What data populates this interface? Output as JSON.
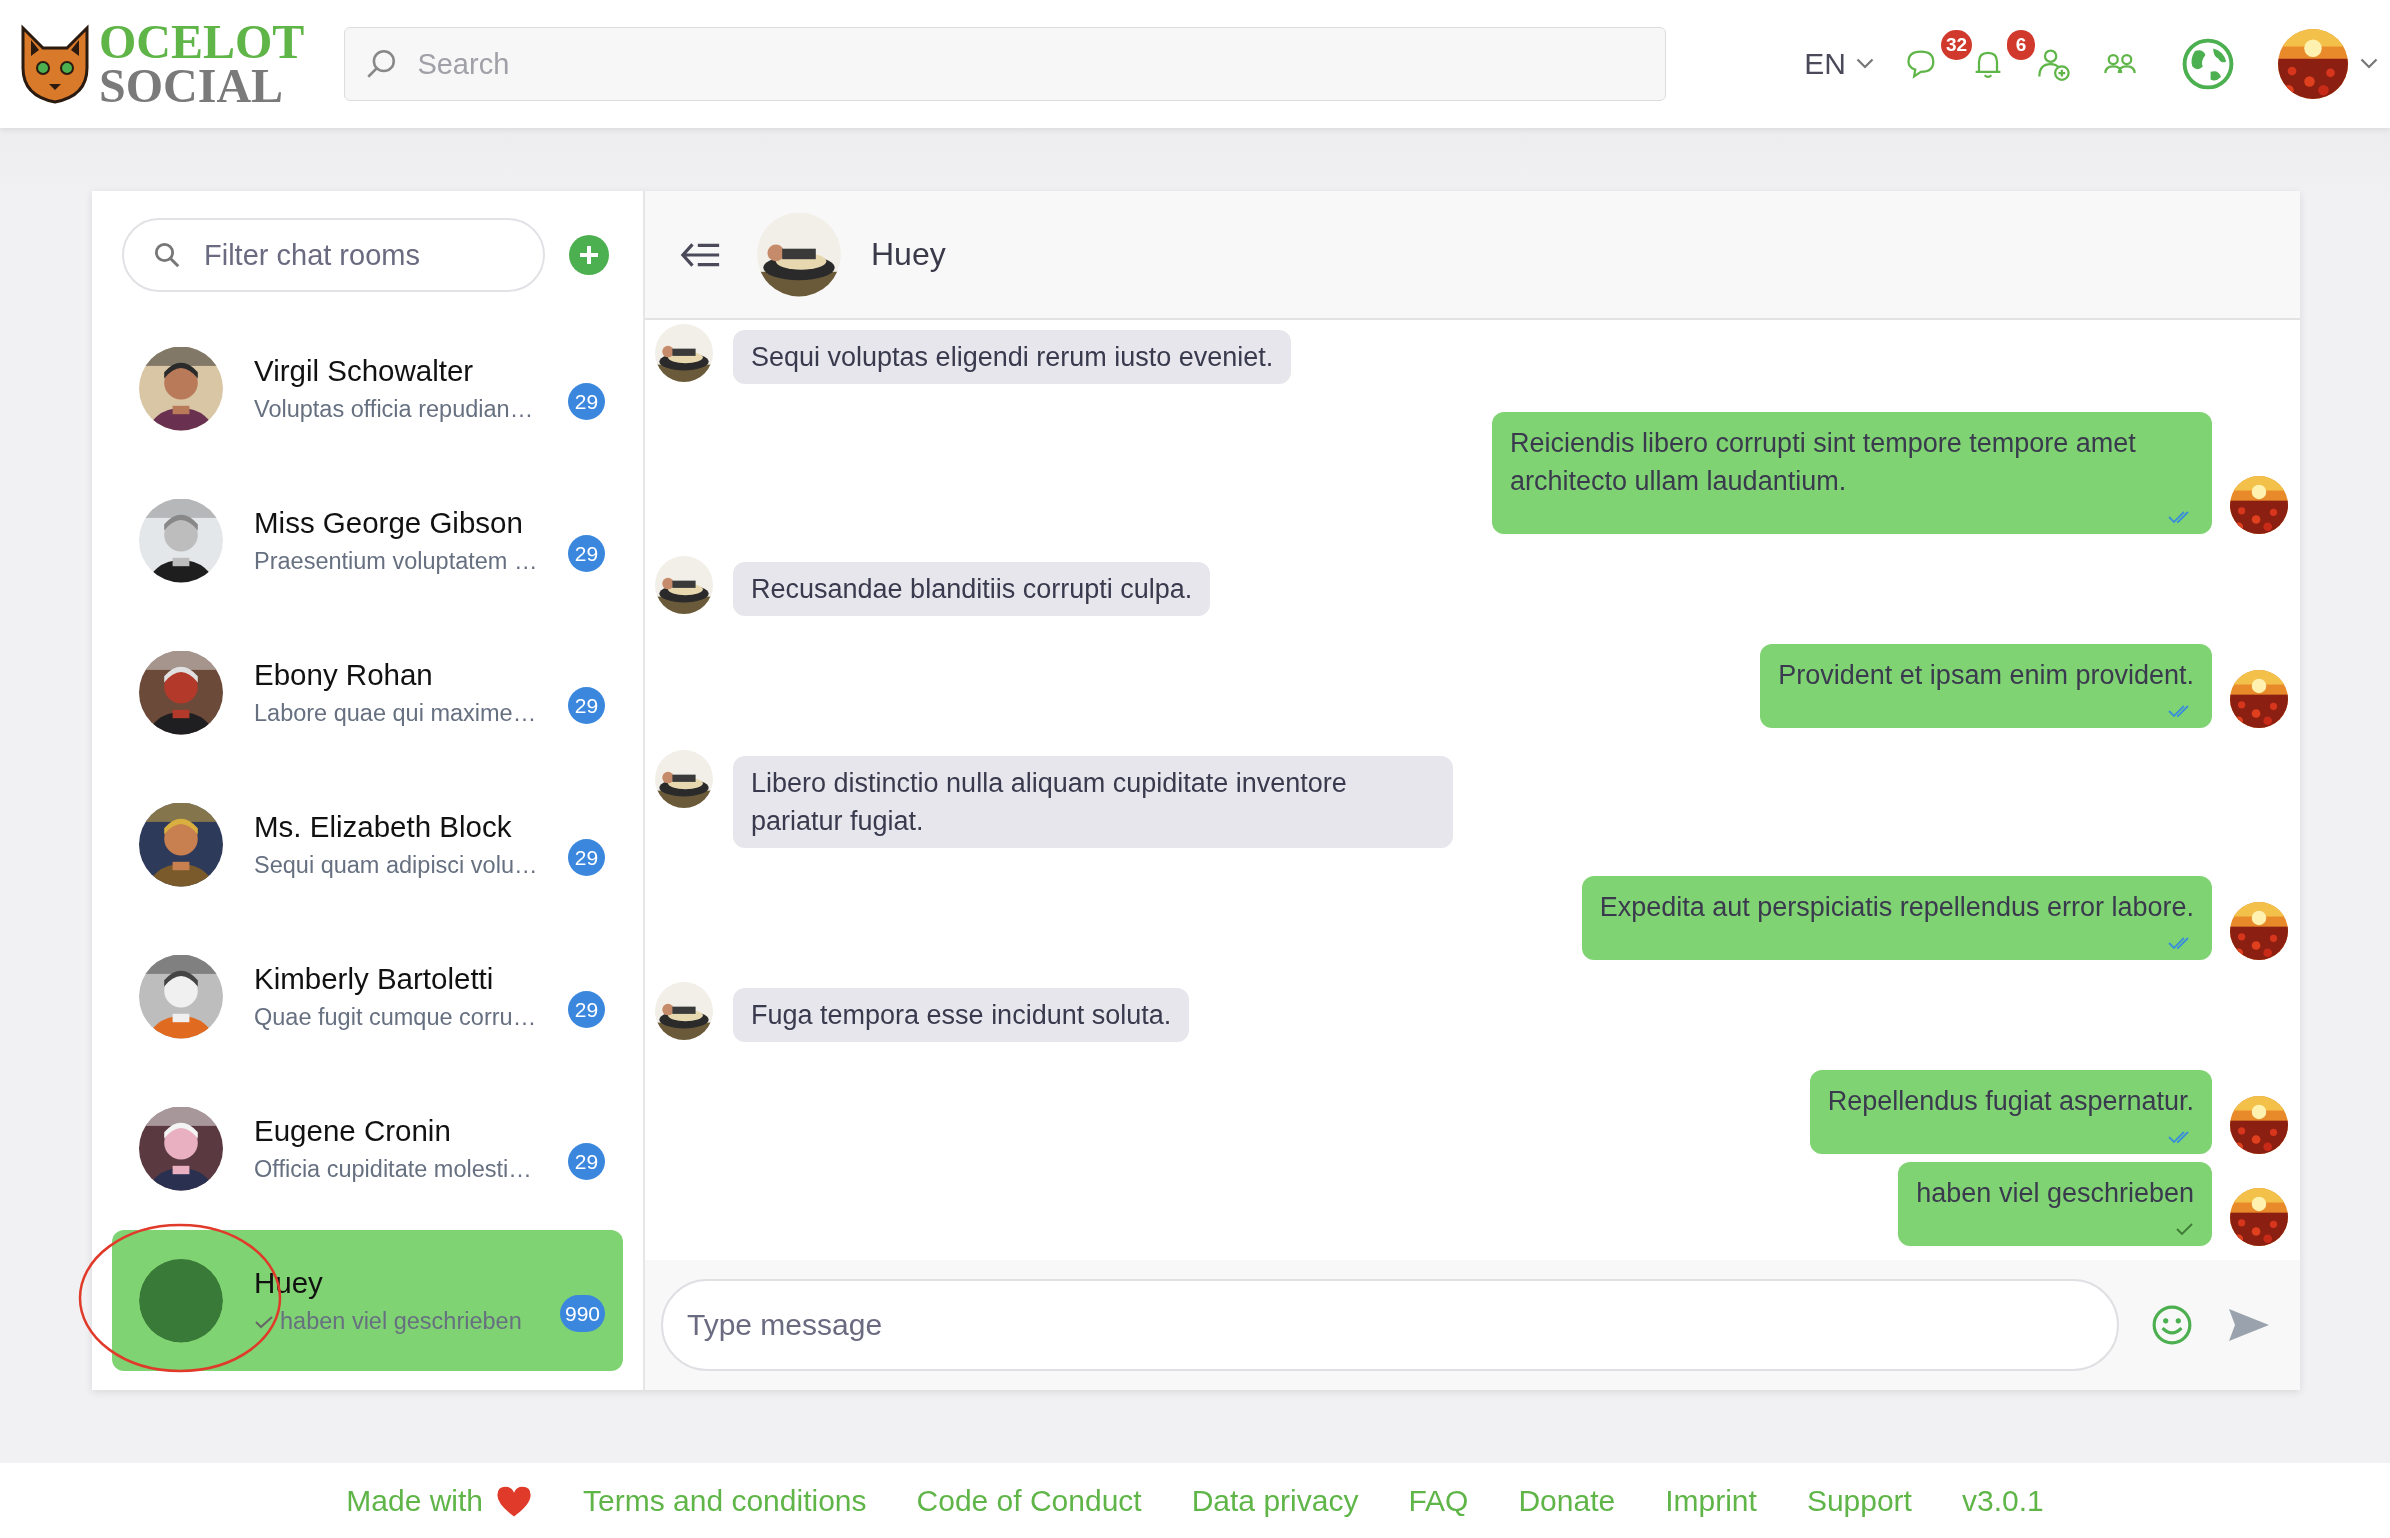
{
  "header": {
    "logo": {
      "line_1": "OCELOT",
      "line_2": "SOCIAL"
    },
    "search": {
      "placeholder": "Search"
    },
    "language": "EN",
    "chat_badge": "32",
    "notification_badge": "6"
  },
  "chat_list": {
    "filter": {
      "placeholder": "Filter chat rooms"
    },
    "rooms": [
      {
        "name": "Virgil Schowalter",
        "preview": "Voluptas officia repudian…",
        "unread": "29",
        "has_photo": true,
        "check": false,
        "selected": false
      },
      {
        "name": "Miss George Gibson",
        "preview": "Praesentium voluptatem …",
        "unread": "29",
        "has_photo": true,
        "check": false,
        "selected": false
      },
      {
        "name": "Ebony Rohan",
        "preview": "Labore quae qui maxime…",
        "unread": "29",
        "has_photo": true,
        "check": false,
        "selected": false
      },
      {
        "name": "Ms. Elizabeth Block",
        "preview": "Sequi quam adipisci volu…",
        "unread": "29",
        "has_photo": true,
        "check": false,
        "selected": false
      },
      {
        "name": "Kimberly Bartoletti",
        "preview": "Quae fugit cumque corru…",
        "unread": "29",
        "has_photo": true,
        "check": false,
        "selected": false
      },
      {
        "name": "Eugene Cronin",
        "preview": "Officia cupiditate molesti…",
        "unread": "29",
        "has_photo": true,
        "check": false,
        "selected": false
      },
      {
        "name": "Huey",
        "preview": "haben viel geschrieben",
        "unread": "990",
        "has_photo": false,
        "check": true,
        "selected": true
      }
    ]
  },
  "conversation": {
    "title": "Huey",
    "messages": [
      {
        "kind": "incoming",
        "text": "Sequi voluptas eligendi rerum iusto eveniet."
      },
      {
        "kind": "outgoing",
        "text": "Reiciendis libero corrupti sint tempore tempore amet architecto ullam laudantium.",
        "read": true
      },
      {
        "kind": "incoming",
        "text": "Recusandae blanditiis corrupti culpa."
      },
      {
        "kind": "outgoing",
        "text": "Provident et ipsam enim provident.",
        "read": true
      },
      {
        "kind": "incoming",
        "text": "Libero distinctio nulla aliquam cupiditate inventore pariatur fugiat."
      },
      {
        "kind": "outgoing",
        "text": "Expedita aut perspiciatis repellendus error labore.",
        "read": true
      },
      {
        "kind": "incoming",
        "text": "Fuga tempora esse incidunt soluta."
      },
      {
        "kind": "outgoing",
        "text": "Repellendus fugiat aspernatur.",
        "read": true
      },
      {
        "kind": "outgoing",
        "text": "haben viel geschrieben",
        "read": false
      }
    ],
    "composer": {
      "placeholder": "Type message"
    }
  },
  "footer": {
    "made_with": "Made with",
    "links": [
      "Terms and conditions",
      "Code of Conduct",
      "Data privacy",
      "FAQ",
      "Donate",
      "Imprint",
      "Support",
      "v3.0.1"
    ]
  }
}
